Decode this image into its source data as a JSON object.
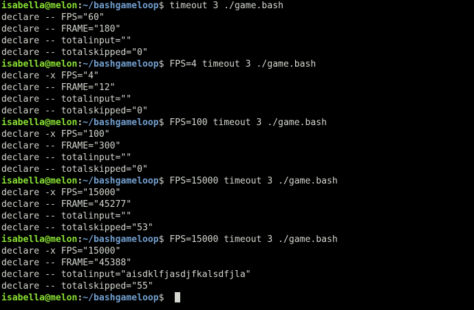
{
  "prompt": {
    "user_host": "isabella@melon",
    "separator": ":",
    "path": "~/bashgameloop",
    "symbol": "$"
  },
  "blocks": [
    {
      "command": "timeout 3 ./game.bash",
      "output": [
        "declare -- FPS=\"60\"",
        "declare -- FRAME=\"180\"",
        "declare -- totalinput=\"\"",
        "declare -- totalskipped=\"0\""
      ]
    },
    {
      "command": "FPS=4 timeout 3 ./game.bash",
      "output": [
        "declare -x FPS=\"4\"",
        "declare -- FRAME=\"12\"",
        "declare -- totalinput=\"\"",
        "declare -- totalskipped=\"0\""
      ]
    },
    {
      "command": "FPS=100 timeout 3 ./game.bash",
      "output": [
        "declare -x FPS=\"100\"",
        "declare -- FRAME=\"300\"",
        "declare -- totalinput=\"\"",
        "declare -- totalskipped=\"0\""
      ]
    },
    {
      "command": "FPS=15000 timeout 3 ./game.bash",
      "output": [
        "declare -x FPS=\"15000\"",
        "declare -- FRAME=\"45277\"",
        "declare -- totalinput=\"\"",
        "declare -- totalskipped=\"53\""
      ]
    },
    {
      "command": "FPS=15000 timeout 3 ./game.bash",
      "output": [
        "declare -x FPS=\"15000\"",
        "declare -- FRAME=\"45388\"",
        "declare -- totalinput=\"aisdklfjasdjfkalsdfjla\"",
        "declare -- totalskipped=\"55\""
      ]
    }
  ],
  "final_prompt": {
    "command": ""
  },
  "colors": {
    "background": "#000000",
    "foreground": "#d3d7cf",
    "user_host": "#8ae234",
    "path": "#729fcf"
  }
}
